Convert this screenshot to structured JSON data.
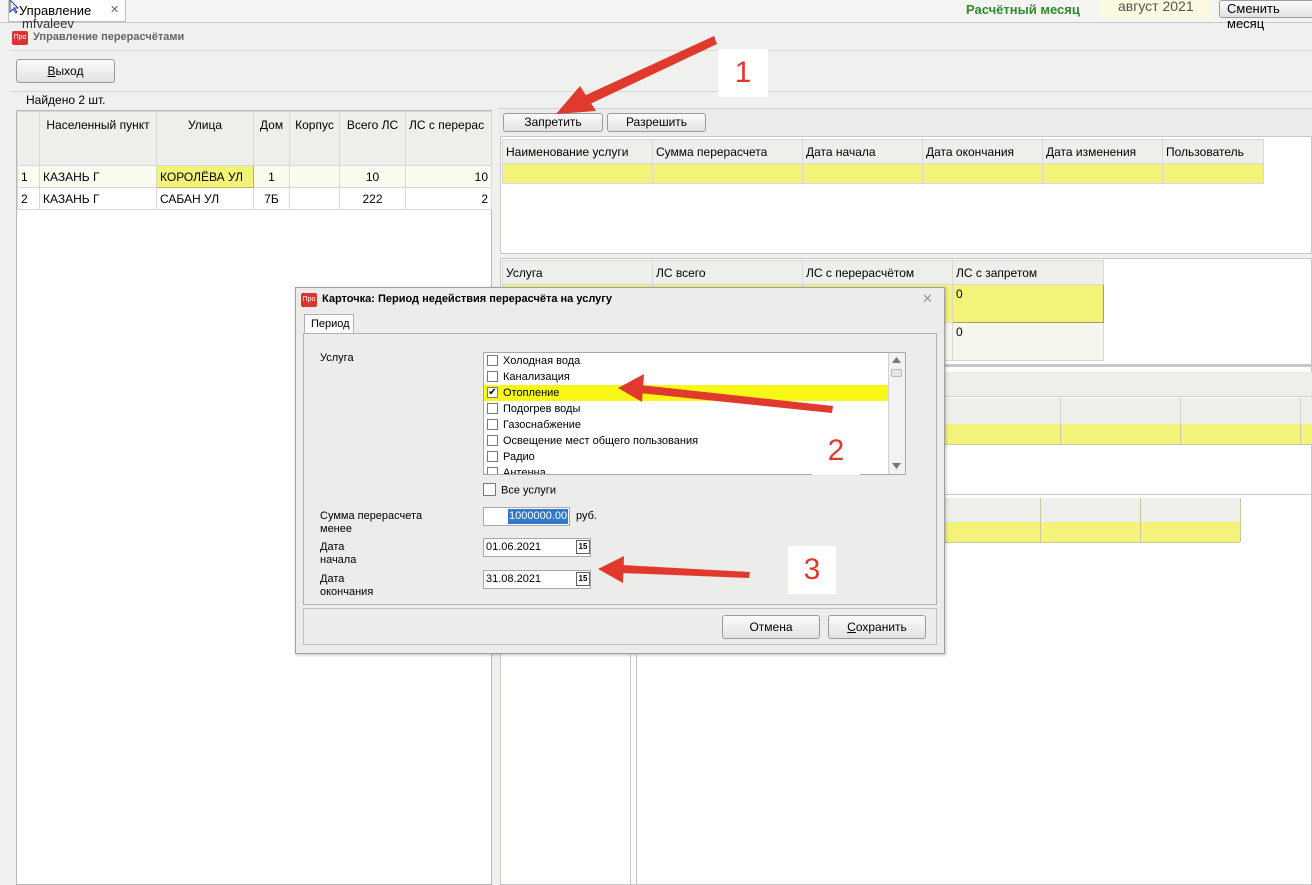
{
  "topbar": {
    "tab_label": "Управление",
    "user": "mfvaleev",
    "close_glyph": "✕",
    "billing_month_label": "Расчётный месяц",
    "billing_month_value": "август 2021",
    "change_month_button": "Сменить месяц"
  },
  "window": {
    "logo": "Про",
    "title": "Управление перерасчётами",
    "exit_button": "Выход",
    "found_label": "Найдено 2 шт."
  },
  "houses_table": {
    "headers": [
      "Населенный пункт",
      "Улица",
      "Дом",
      "Корпус",
      "Всего ЛС",
      "ЛС с перерас"
    ],
    "rows": [
      {
        "n": "1",
        "city": "КАЗАНЬ Г",
        "street": "КОРОЛЁВА УЛ",
        "house": "1",
        "korpus": "",
        "total": "10",
        "recalc": "10"
      },
      {
        "n": "2",
        "city": "КАЗАНЬ Г",
        "street": "САБАН УЛ",
        "house": "7Б",
        "korpus": "",
        "total": "222",
        "recalc": "2"
      }
    ]
  },
  "right_panel": {
    "forbid_button": "Запретить",
    "allow_button": "Разрешить",
    "bans_headers": [
      "Наименование услуги",
      "Сумма перерасчета",
      "Дата начала",
      "Дата окончания",
      "Дата изменения",
      "Пользователь"
    ],
    "services_headers": [
      "Услуга",
      "ЛС всего",
      "ЛС с перерасчётом",
      "ЛС с запретом"
    ],
    "services_rows": [
      {
        "ban": "0"
      },
      {
        "ban": "0"
      }
    ]
  },
  "dialog": {
    "logo": "Про",
    "title": "Карточка: Период недействия перерасчёта на услугу",
    "close_glyph": "✕",
    "tab": "Период",
    "service_label": "Услуга",
    "services": [
      {
        "name": "Холодная вода",
        "checked": false
      },
      {
        "name": "Канализация",
        "checked": false
      },
      {
        "name": "Отопление",
        "checked": true
      },
      {
        "name": "Подогрев воды",
        "checked": false
      },
      {
        "name": "Газоснабжение",
        "checked": false
      },
      {
        "name": "Освещение мест общего пользования",
        "checked": false
      },
      {
        "name": "Радио",
        "checked": false
      },
      {
        "name": "Антенна",
        "checked": false
      }
    ],
    "all_services_label": "Все услуги",
    "sum_label_1": "Сумма перерасчета",
    "sum_label_2": "менее",
    "sum_value": "1000000.00",
    "currency": "руб.",
    "start_label_1": "Дата",
    "start_label_2": "начала",
    "start_value": "01.06.2021",
    "end_label_1": "Дата",
    "end_label_2": "окончания",
    "end_value": "31.08.2021",
    "calendar_glyph": "15",
    "cancel_button": "Отмена",
    "save_button": "Сохранить"
  },
  "annotations": [
    "1",
    "2",
    "3"
  ],
  "colors": {
    "highlight": "#f3f37a",
    "month_label": "#2e8b2e",
    "arrow": "#e03a2e",
    "selection": "#3178c6"
  }
}
